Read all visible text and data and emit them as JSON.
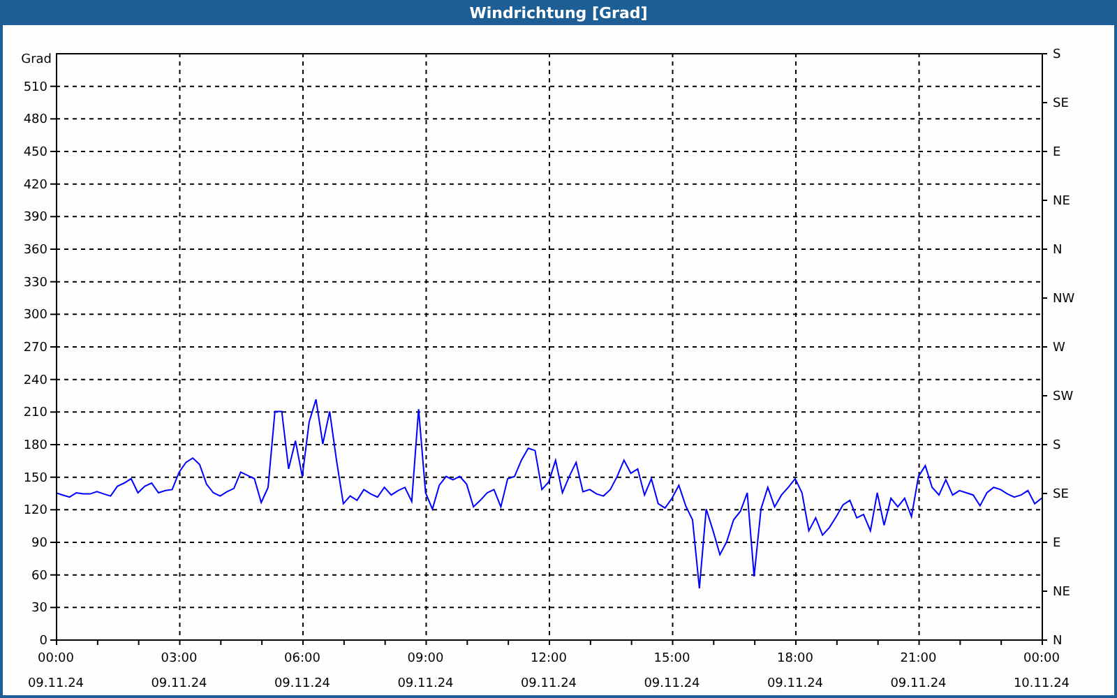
{
  "window": {
    "title": "Windrichtung [Grad]"
  },
  "chart": {
    "direction_axis": [
      "S",
      "SE",
      "E",
      "NE",
      "N",
      "NW",
      "W",
      "SW",
      "S",
      "SE",
      "E",
      "NE",
      "N"
    ],
    "chart_data": {
      "type": "line",
      "grid": true,
      "ylabel": "Grad",
      "ylim": [
        0,
        540
      ],
      "yticks": [
        0,
        30,
        60,
        90,
        120,
        150,
        180,
        210,
        240,
        270,
        300,
        330,
        360,
        390,
        420,
        450,
        480,
        510
      ],
      "categories": [
        "00:00",
        null,
        null,
        null,
        null,
        null,
        null,
        null,
        null,
        null,
        null,
        null,
        null,
        null,
        null,
        null,
        null,
        null,
        "03:00",
        null,
        null,
        null,
        null,
        null,
        null,
        null,
        null,
        null,
        null,
        null,
        null,
        null,
        null,
        null,
        null,
        null,
        "06:00",
        null,
        null,
        null,
        null,
        null,
        null,
        null,
        null,
        null,
        null,
        null,
        null,
        null,
        null,
        null,
        null,
        null,
        "09:00",
        null,
        null,
        null,
        null,
        null,
        null,
        null,
        null,
        null,
        null,
        null,
        null,
        null,
        null,
        null,
        null,
        null,
        "12:00",
        null,
        null,
        null,
        null,
        null,
        null,
        null,
        null,
        null,
        null,
        null,
        null,
        null,
        null,
        null,
        null,
        null,
        "15:00",
        null,
        null,
        null,
        null,
        null,
        null,
        null,
        null,
        null,
        null,
        null,
        null,
        null,
        null,
        null,
        null,
        null,
        "18:00",
        null,
        null,
        null,
        null,
        null,
        null,
        null,
        null,
        null,
        null,
        null,
        null,
        null,
        null,
        null,
        null,
        null,
        "21:00",
        null,
        null,
        null,
        null,
        null,
        null,
        null,
        null,
        null,
        null,
        null,
        null,
        null,
        null,
        null,
        null,
        null,
        "00:00"
      ],
      "series": [
        {
          "color": "#0000ff",
          "values": [
            135,
            133,
            131,
            135,
            134,
            134,
            136,
            134,
            132,
            141,
            144,
            148,
            135,
            141,
            144,
            135,
            137,
            138,
            154,
            163,
            167,
            161,
            143,
            135,
            132,
            136,
            139,
            154,
            151,
            148,
            126,
            140,
            210,
            210,
            157,
            183,
            150,
            200,
            221,
            180,
            210,
            165,
            125,
            132,
            128,
            138,
            134,
            131,
            140,
            133,
            137,
            140,
            127,
            212,
            135,
            120,
            142,
            150,
            147,
            150,
            143,
            122,
            128,
            135,
            138,
            122,
            148,
            150,
            165,
            176,
            174,
            138,
            145,
            165,
            135,
            150,
            163,
            136,
            138,
            134,
            132,
            138,
            150,
            165,
            153,
            157,
            133,
            148,
            125,
            121,
            130,
            142,
            123,
            110,
            47,
            120,
            100,
            78,
            90,
            110,
            118,
            135,
            58,
            120,
            140,
            122,
            133,
            140,
            148,
            135,
            100,
            112,
            96,
            103,
            113,
            124,
            128,
            112,
            115,
            100,
            135,
            105,
            130,
            122,
            130,
            113,
            150,
            160,
            140,
            133,
            147,
            133,
            137,
            135,
            133,
            123,
            135,
            140,
            138,
            134,
            131,
            133,
            137,
            125,
            130
          ]
        }
      ]
    },
    "dates": [
      "09.11.24",
      "09.11.24",
      "09.11.24",
      "09.11.24",
      "09.11.24",
      "09.11.24",
      "09.11.24",
      "09.11.24",
      "10.11.24"
    ]
  }
}
